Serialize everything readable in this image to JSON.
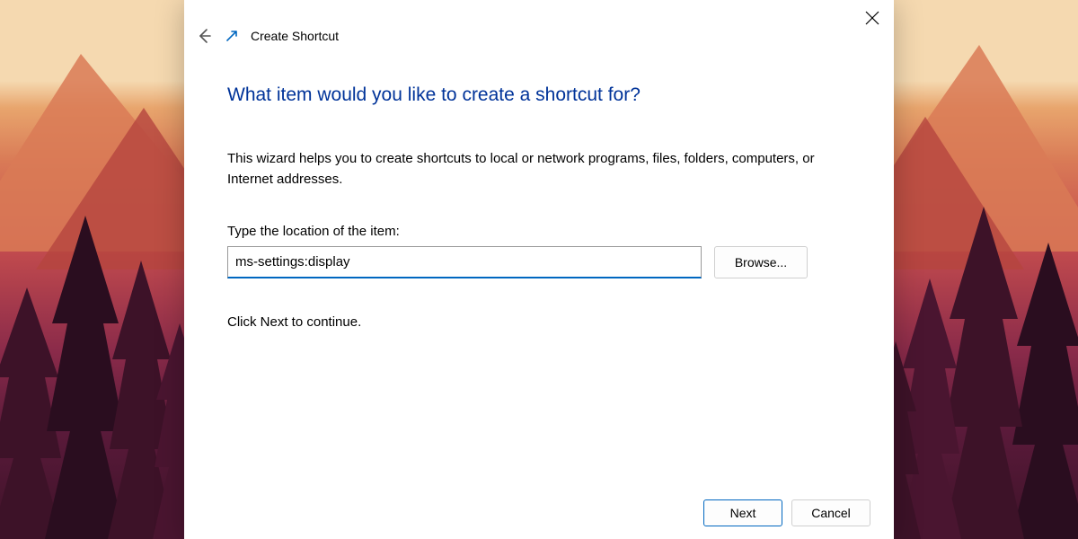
{
  "dialog": {
    "header": {
      "title": "Create Shortcut"
    },
    "heading": "What item would you like to create a shortcut for?",
    "description": "This wizard helps you to create shortcuts to local or network programs, files, folders, computers, or Internet addresses.",
    "field_label": "Type the location of the item:",
    "location_value": "ms-settings:display",
    "browse_label": "Browse...",
    "continue_text": "Click Next to continue.",
    "buttons": {
      "next": "Next",
      "cancel": "Cancel"
    }
  }
}
